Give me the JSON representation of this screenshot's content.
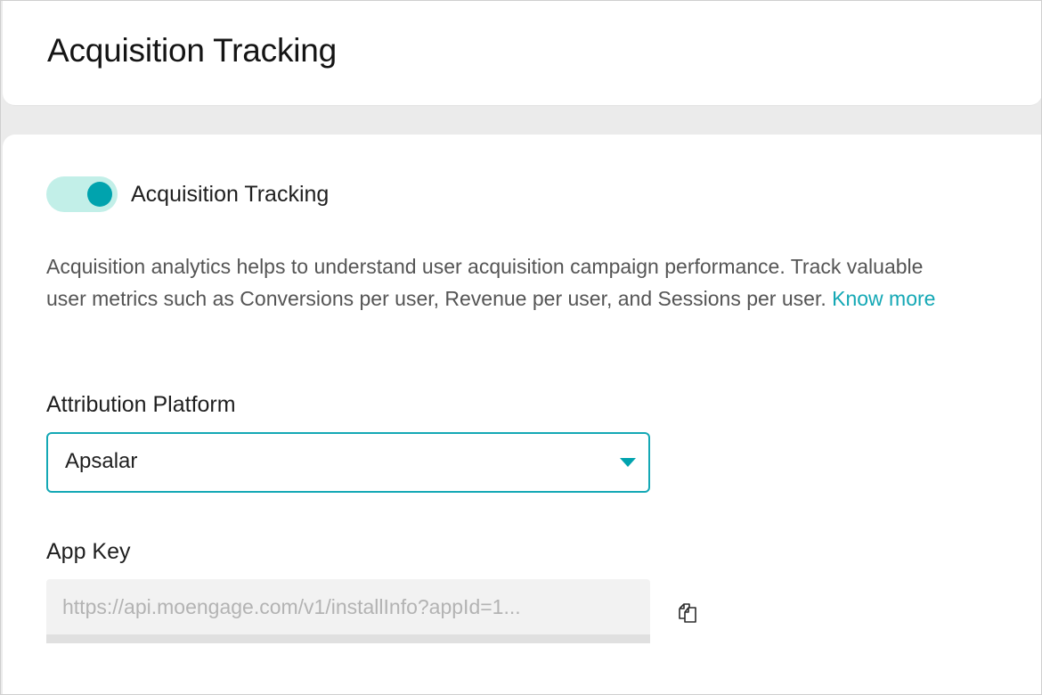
{
  "header": {
    "title": "Acquisition Tracking"
  },
  "tracking": {
    "toggle_label": "Acquisition Tracking",
    "toggle_state": "on",
    "description": "Acquisition analytics helps to understand user acquisition campaign performance. Track valuable user metrics such as Conversions per user, Revenue per user, and Sessions per user.",
    "know_more_label": "Know more"
  },
  "attribution": {
    "label": "Attribution Platform",
    "selected": "Apsalar",
    "arrow_icon": "caret-down-icon"
  },
  "app_key": {
    "label": "App Key",
    "value": "https://api.moengage.com/v1/installInfo?appId=1...",
    "copy_icon": "copy-icon"
  },
  "colors": {
    "accent": "#00a3ae",
    "link": "#14a8b5",
    "toggle_track": "#c2efe8"
  }
}
